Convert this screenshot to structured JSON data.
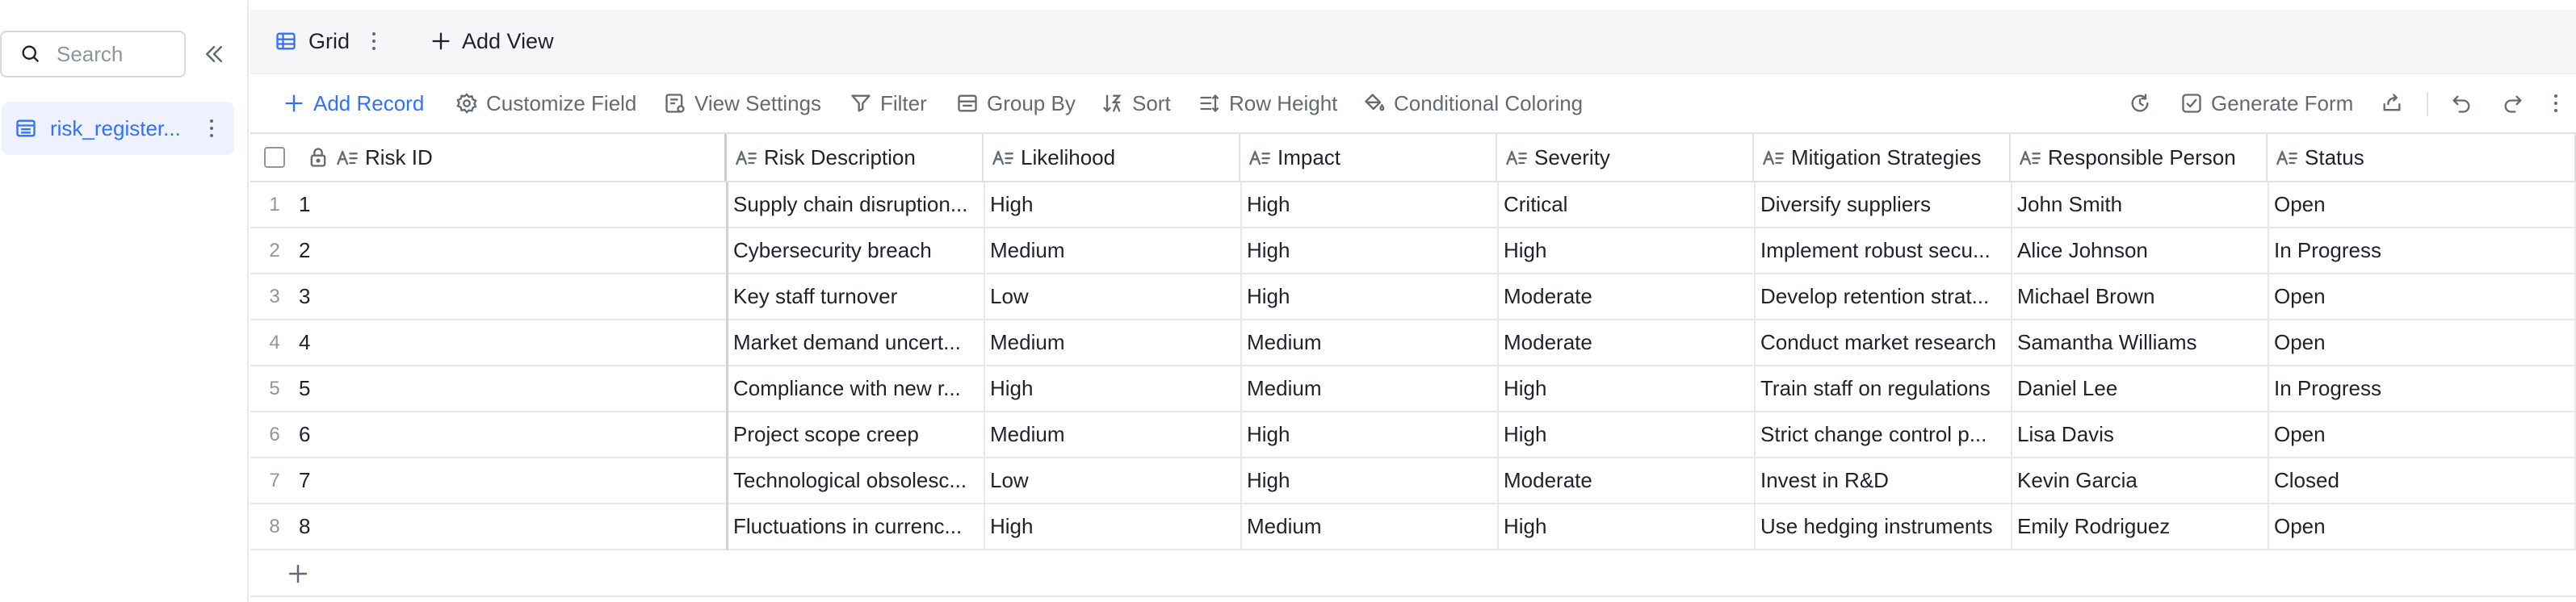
{
  "sidebar": {
    "search_placeholder": "Search",
    "table_name": "risk_register..."
  },
  "views": {
    "active_tab": "Grid",
    "add_view": "Add View"
  },
  "toolbar": {
    "add_record": "Add Record",
    "customize_field": "Customize Field",
    "view_settings": "View Settings",
    "filter": "Filter",
    "group_by": "Group By",
    "sort": "Sort",
    "row_height": "Row Height",
    "conditional_coloring": "Conditional Coloring",
    "generate_form": "Generate Form"
  },
  "colors": {
    "accent": "#3370ff",
    "text": "#1f2329",
    "muted": "#646a73",
    "border": "#dee0e3"
  },
  "grid": {
    "columns": [
      "Risk ID",
      "Risk Description",
      "Likelihood",
      "Impact",
      "Severity",
      "Mitigation Strategies",
      "Responsible Person",
      "Status"
    ],
    "rows": [
      {
        "num": "1",
        "cells": [
          "1",
          "Supply chain disruption...",
          "High",
          "High",
          "Critical",
          "Diversify suppliers",
          "John Smith",
          "Open"
        ]
      },
      {
        "num": "2",
        "cells": [
          "2",
          "Cybersecurity breach",
          "Medium",
          "High",
          "High",
          "Implement robust secu...",
          "Alice Johnson",
          "In Progress"
        ]
      },
      {
        "num": "3",
        "cells": [
          "3",
          "Key staff turnover",
          "Low",
          "High",
          "Moderate",
          "Develop retention strat...",
          "Michael Brown",
          "Open"
        ]
      },
      {
        "num": "4",
        "cells": [
          "4",
          "Market demand uncert...",
          "Medium",
          "Medium",
          "Moderate",
          "Conduct market research",
          "Samantha Williams",
          "Open"
        ]
      },
      {
        "num": "5",
        "cells": [
          "5",
          "Compliance with new r...",
          "High",
          "Medium",
          "High",
          "Train staff on regulations",
          "Daniel Lee",
          "In Progress"
        ]
      },
      {
        "num": "6",
        "cells": [
          "6",
          "Project scope creep",
          "Medium",
          "High",
          "High",
          "Strict change control p...",
          "Lisa Davis",
          "Open"
        ]
      },
      {
        "num": "7",
        "cells": [
          "7",
          "Technological obsolesc...",
          "Low",
          "High",
          "Moderate",
          "Invest in R&D",
          "Kevin Garcia",
          "Closed"
        ]
      },
      {
        "num": "8",
        "cells": [
          "8",
          "Fluctuations in currenc...",
          "High",
          "Medium",
          "High",
          "Use hedging instruments",
          "Emily Rodriguez",
          "Open"
        ]
      }
    ]
  }
}
